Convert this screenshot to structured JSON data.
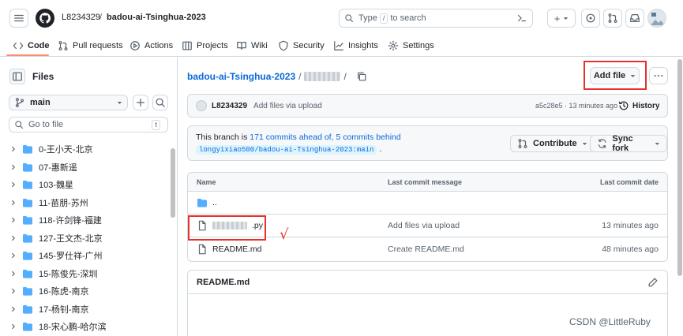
{
  "header": {
    "owner": "L8234329",
    "repo": "badou-ai-Tsinghua-2023",
    "search_prefix": "Type",
    "search_key": "/",
    "search_suffix": "to search",
    "plus_label": "+"
  },
  "nav": {
    "tabs": [
      {
        "label": "Code",
        "icon": "code-icon"
      },
      {
        "label": "Pull requests",
        "icon": "pull-request-icon"
      },
      {
        "label": "Actions",
        "icon": "play-icon"
      },
      {
        "label": "Projects",
        "icon": "table-icon"
      },
      {
        "label": "Wiki",
        "icon": "book-icon"
      },
      {
        "label": "Security",
        "icon": "shield-icon"
      },
      {
        "label": "Insights",
        "icon": "graph-icon"
      },
      {
        "label": "Settings",
        "icon": "gear-icon"
      }
    ]
  },
  "sidebar": {
    "title": "Files",
    "branch": "main",
    "goto_placeholder": "Go to file",
    "goto_key": "t",
    "folders": [
      "0-王小天-北京",
      "07-惠新遥",
      "103-魏星",
      "11-苗朋-苏州",
      "118-许剑锋-福建",
      "127-王文杰-北京",
      "145-罗仕祥-广州",
      "15-陈俊先-深圳",
      "16-陈虎-南京",
      "17-杨钊-南京",
      "18-宋心鹏-哈尔滨"
    ]
  },
  "main": {
    "repo_link": "badou-ai-Tsinghua-2023",
    "separator": "/",
    "add_file": "Add file",
    "commit": {
      "author": "L8234329",
      "message": "Add files via upload",
      "meta": "a5c28e5 · 13 minutes ago",
      "history": "History"
    },
    "ahead": {
      "prefix": "This branch is",
      "ahead_link": "171 commits ahead of,",
      "behind_link": "5 commits behind",
      "ref": "longyixiao500/badou-ai-Tsinghua-2023:main",
      "ref_suffix": ".",
      "contribute": "Contribute",
      "sync": "Sync fork"
    },
    "table": {
      "headers": [
        "Name",
        "Last commit message",
        "Last commit date"
      ],
      "parent_dir": "..",
      "rows": [
        {
          "name_suffix": ".py",
          "message": "Add files via upload",
          "date": "13 minutes ago"
        },
        {
          "name": "README.md",
          "message": "Create README.md",
          "date": "48 minutes ago"
        }
      ]
    },
    "readme_title": "README.md",
    "annotation_check": "√"
  },
  "watermark": "CSDN @LittleRuby",
  "colors": {
    "accent": "#0969da",
    "annotation": "#e5322d",
    "tab_underline": "#fd8c73",
    "folder": "#54aeff"
  }
}
